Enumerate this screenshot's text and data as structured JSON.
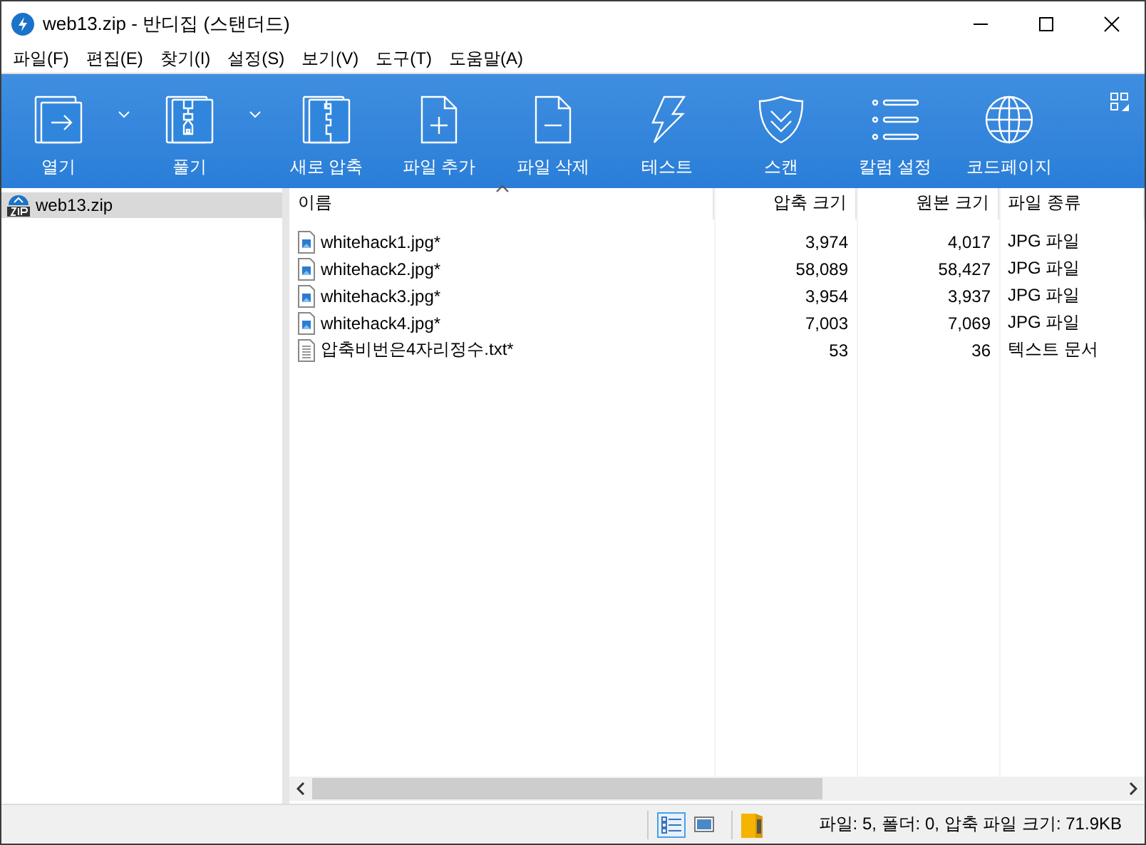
{
  "window": {
    "title": "web13.zip - 반디집 (스탠더드)"
  },
  "menu": [
    "파일(F)",
    "편집(E)",
    "찾기(I)",
    "설정(S)",
    "보기(V)",
    "도구(T)",
    "도움말(A)"
  ],
  "toolbar": [
    {
      "label": "열기",
      "kind": "open",
      "dropdown": true
    },
    {
      "label": "풀기",
      "kind": "extract",
      "dropdown": true
    },
    {
      "label": "새로 압축",
      "kind": "new",
      "dropdown": false
    },
    {
      "label": "파일 추가",
      "kind": "add",
      "dropdown": false
    },
    {
      "label": "파일 삭제",
      "kind": "delete",
      "dropdown": false
    },
    {
      "label": "테스트",
      "kind": "test",
      "dropdown": false
    },
    {
      "label": "스캔",
      "kind": "scan",
      "dropdown": false
    },
    {
      "label": "칼럼 설정",
      "kind": "columns",
      "dropdown": false
    },
    {
      "label": "코드페이지",
      "kind": "globe",
      "dropdown": false
    }
  ],
  "sidebar": {
    "items": [
      {
        "label": "web13.zip",
        "selected": true
      }
    ]
  },
  "table": {
    "columns": [
      {
        "label": "이름",
        "sorted": true
      },
      {
        "label": "압축 크기",
        "sorted": false
      },
      {
        "label": "원본 크기",
        "sorted": false
      },
      {
        "label": "파일 종류",
        "sorted": false
      }
    ],
    "rows": [
      {
        "kind": "image",
        "cells": [
          "whitehack1.jpg*",
          "3,974",
          "4,017",
          "JPG 파일"
        ]
      },
      {
        "kind": "image",
        "cells": [
          "whitehack2.jpg*",
          "58,089",
          "58,427",
          "JPG 파일"
        ]
      },
      {
        "kind": "image",
        "cells": [
          "whitehack3.jpg*",
          "3,954",
          "3,937",
          "JPG 파일"
        ]
      },
      {
        "kind": "image",
        "cells": [
          "whitehack4.jpg*",
          "7,003",
          "7,069",
          "JPG 파일"
        ]
      },
      {
        "kind": "text",
        "cells": [
          "압축비번은4자리정수.txt*",
          "53",
          "36",
          "텍스트 문서"
        ]
      }
    ]
  },
  "status_bar": {
    "views": [
      {
        "kind": "details",
        "selected": true
      },
      {
        "kind": "thumbnails",
        "selected": false
      }
    ],
    "text": "파일: 5, 폴더: 0, 압축 파일 크기: 71.9KB"
  }
}
